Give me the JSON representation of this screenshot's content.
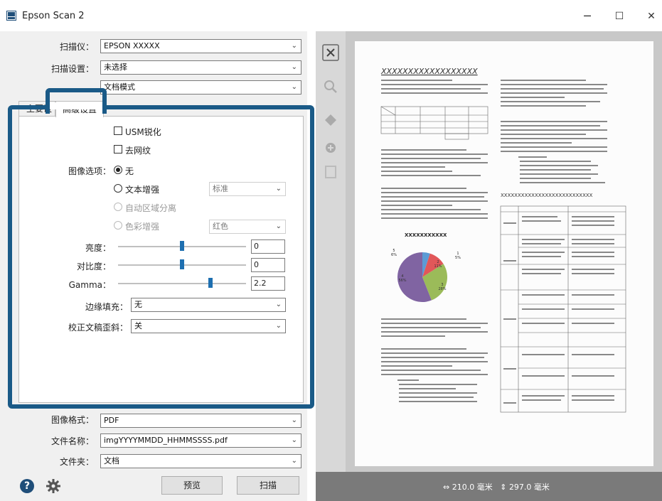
{
  "window": {
    "title": "Epson Scan 2",
    "minimize": "─",
    "maximize": "☐",
    "close": "✕"
  },
  "settings": {
    "scanner_label": "扫描仪：",
    "scanner_value": "EPSON XXXXX",
    "scan_settings_label": "扫描设置：",
    "scan_settings_value": "未选择",
    "mode_value": "文档模式"
  },
  "tabs": {
    "main": "主要设置",
    "advanced": "高级设置"
  },
  "advanced": {
    "usm": "USM锐化",
    "descreen": "去网纹",
    "image_option_label": "图像选项：",
    "opt_none": "无",
    "opt_text": "文本增强",
    "opt_text_combo": "标准",
    "opt_auto_area": "自动区域分离",
    "opt_color": "色彩增强",
    "opt_color_combo": "红色",
    "brightness_label": "亮度：",
    "brightness_value": "0",
    "contrast_label": "对比度：",
    "contrast_value": "0",
    "gamma_label": "Gamma：",
    "gamma_value": "2.2",
    "edge_fill_label": "边缘填充：",
    "edge_fill_value": "无",
    "skew_label": "校正文稿歪斜：",
    "skew_value": "关"
  },
  "output": {
    "format_label": "图像格式：",
    "format_value": "PDF",
    "filename_label": "文件名称：",
    "filename_value": "imgYYYYMMDD_HHMMSSSS.pdf",
    "folder_label": "文件夹：",
    "folder_value": "文档"
  },
  "actions": {
    "preview": "预览",
    "scan": "扫描",
    "help": "?"
  },
  "sliders": {
    "brightness_level": 0.5,
    "contrast_level": 0.5,
    "gamma_level": 0.72
  },
  "status": {
    "width": "210.0 毫米",
    "height": "297.0 毫米"
  },
  "document": {
    "heading": "XXXXXXXXXXXXXXXXXX",
    "heading2": "XXXXXXXXXXXXXXXXXXXXXXXXXXX",
    "chart_title": "XXXXXXXXXXX",
    "pie": {
      "slices": [
        5,
        11,
        28,
        56
      ],
      "labels": [
        "5\n6%",
        "1\n5%",
        "2\n11%",
        "3\n28%",
        "4\n56%"
      ]
    }
  },
  "colors": {
    "accent": "#1a5a87",
    "slider": "#1e6fb0",
    "status_bg": "#7a7a7a"
  }
}
